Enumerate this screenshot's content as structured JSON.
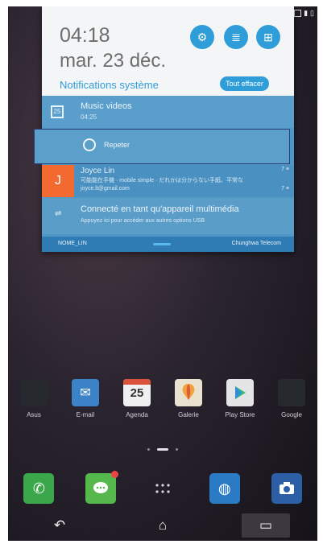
{
  "shade": {
    "time": "04:18",
    "date": "mar. 23 déc.",
    "notifications_title": "Notifications système",
    "clear_button": "Tout effacer",
    "quick_icons": [
      "settings-icon",
      "notes-icon",
      "grid-icon"
    ]
  },
  "notifications": {
    "music": {
      "title": "Music videos",
      "time": "04:25",
      "icon_text": "25"
    },
    "repeat": {
      "label": "Repeter"
    },
    "mail": {
      "initial": "J",
      "from": "Joyce Lin",
      "preview": "可能能在手機 · mobile simple · だれかは分からない手紙、平常な",
      "address": "joyce.lt@gmail.com",
      "time": "7 ≡",
      "count": "7 ≡"
    },
    "usb": {
      "title": "Connecté en tant qu'appareil multimédia",
      "subtitle": "Appuyez ici pour accéder aux autres options USB"
    },
    "footer": {
      "left": "NOME_LIN",
      "right": "Chunghwa Telecom"
    }
  },
  "apps": [
    {
      "label": "Asus",
      "color": "#2b2f35"
    },
    {
      "label": "E-mail",
      "color": "#3b82c7"
    },
    {
      "label": "Agenda",
      "number": "25"
    },
    {
      "label": "Galerie",
      "color": "#e9e2d0"
    },
    {
      "label": "Play Store",
      "color": "#e5e5e5"
    },
    {
      "label": "Google",
      "color": "#2b2f35"
    }
  ],
  "dock": [
    {
      "name": "phone",
      "color": "#3aa84a"
    },
    {
      "name": "messages",
      "color": "#56b84c"
    },
    {
      "name": "all-apps",
      "color": "transparent"
    },
    {
      "name": "browser",
      "color": "#2a7bc4"
    },
    {
      "name": "camera",
      "color": "#2c5fa5"
    }
  ]
}
